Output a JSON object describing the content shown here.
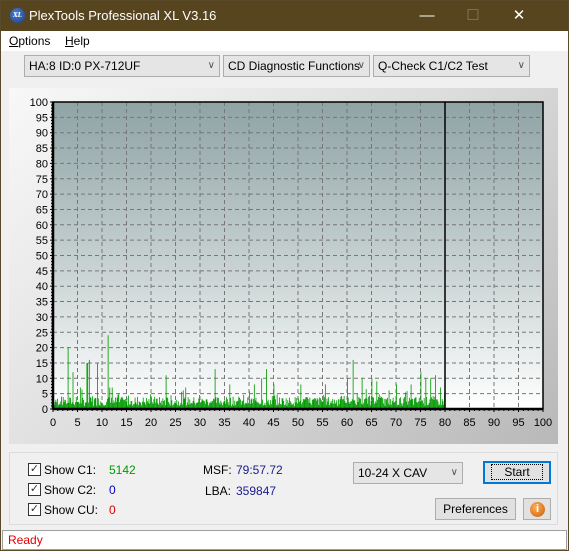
{
  "window": {
    "title": "PlexTools Professional XL V3.16",
    "icon_text": "XL",
    "minimize_glyph": "—",
    "maximize_glyph": "☐",
    "close_glyph": "✕"
  },
  "menu": {
    "items": [
      {
        "label": "Options",
        "accel": "O",
        "rest": "ptions"
      },
      {
        "label": "Help",
        "accel": "H",
        "rest": "elp"
      }
    ]
  },
  "toolbar": {
    "drive_select": "HA:8 ID:0  PX-712UF",
    "function_select": "CD Diagnostic Functions",
    "test_select": "Q-Check C1/C2 Test",
    "arrow_glyph": "∨"
  },
  "colors": {
    "c1": "#009900",
    "c2": "#0000cc",
    "cu": "#dd0000",
    "value_blue": "#1a1a8c",
    "status_red": "#e00000",
    "titlebar": "#574520"
  },
  "chart_data": {
    "type": "bar",
    "title": "",
    "xlabel": "",
    "ylabel": "",
    "xlim": [
      0,
      100
    ],
    "ylim": [
      0,
      100
    ],
    "x_ticks": [
      0,
      5,
      10,
      15,
      20,
      25,
      30,
      35,
      40,
      45,
      50,
      55,
      60,
      65,
      70,
      75,
      80,
      85,
      90,
      95,
      100
    ],
    "y_ticks": [
      0,
      5,
      10,
      15,
      20,
      25,
      30,
      35,
      40,
      45,
      50,
      55,
      60,
      65,
      70,
      75,
      80,
      85,
      90,
      95,
      100
    ],
    "grid": true,
    "data_end_x": 80,
    "series": [
      {
        "name": "C1",
        "color": "#009900",
        "spikes": [
          {
            "x": 3.0,
            "y": 20
          },
          {
            "x": 4.0,
            "y": 12
          },
          {
            "x": 5.5,
            "y": 7
          },
          {
            "x": 6.8,
            "y": 15
          },
          {
            "x": 7.0,
            "y": 15
          },
          {
            "x": 7.3,
            "y": 16
          },
          {
            "x": 9.0,
            "y": 15
          },
          {
            "x": 11.2,
            "y": 24
          },
          {
            "x": 11.5,
            "y": 7
          },
          {
            "x": 12.0,
            "y": 7
          },
          {
            "x": 23.0,
            "y": 11
          },
          {
            "x": 27.0,
            "y": 7
          },
          {
            "x": 33.0,
            "y": 13
          },
          {
            "x": 36.0,
            "y": 8
          },
          {
            "x": 41.0,
            "y": 8
          },
          {
            "x": 42.5,
            "y": 10
          },
          {
            "x": 43.5,
            "y": 13
          },
          {
            "x": 45.0,
            "y": 8
          },
          {
            "x": 50.5,
            "y": 8
          },
          {
            "x": 55.5,
            "y": 8
          },
          {
            "x": 60.0,
            "y": 10
          },
          {
            "x": 61.2,
            "y": 16
          },
          {
            "x": 63.0,
            "y": 10
          },
          {
            "x": 65.0,
            "y": 10
          },
          {
            "x": 66.0,
            "y": 9
          },
          {
            "x": 70.0,
            "y": 8
          },
          {
            "x": 73.0,
            "y": 8
          },
          {
            "x": 75.0,
            "y": 12
          },
          {
            "x": 76.0,
            "y": 10
          },
          {
            "x": 77.0,
            "y": 10
          },
          {
            "x": 78.0,
            "y": 11
          },
          {
            "x": 79.0,
            "y": 7
          }
        ],
        "baseline_range": [
          1,
          4
        ]
      },
      {
        "name": "C2",
        "color": "#0000cc",
        "total": 0
      },
      {
        "name": "CU",
        "color": "#dd0000",
        "total": 0
      }
    ]
  },
  "stats": {
    "show_c1_label": "Show C1:",
    "show_c2_label": "Show C2:",
    "show_cu_label": "Show CU:",
    "c1_value": "5142",
    "c2_value": "0",
    "cu_value": "0",
    "c1_checked": true,
    "c2_checked": true,
    "cu_checked": true,
    "msf_label": "MSF:",
    "msf_value": "79:57.72",
    "lba_label": "LBA:",
    "lba_value": "359847",
    "check_glyph": "✓"
  },
  "controls": {
    "speed_select": "10-24 X CAV",
    "start_label": "Start",
    "preferences_label": "Preferences",
    "info_glyph": "i"
  },
  "status": {
    "text": "Ready"
  }
}
